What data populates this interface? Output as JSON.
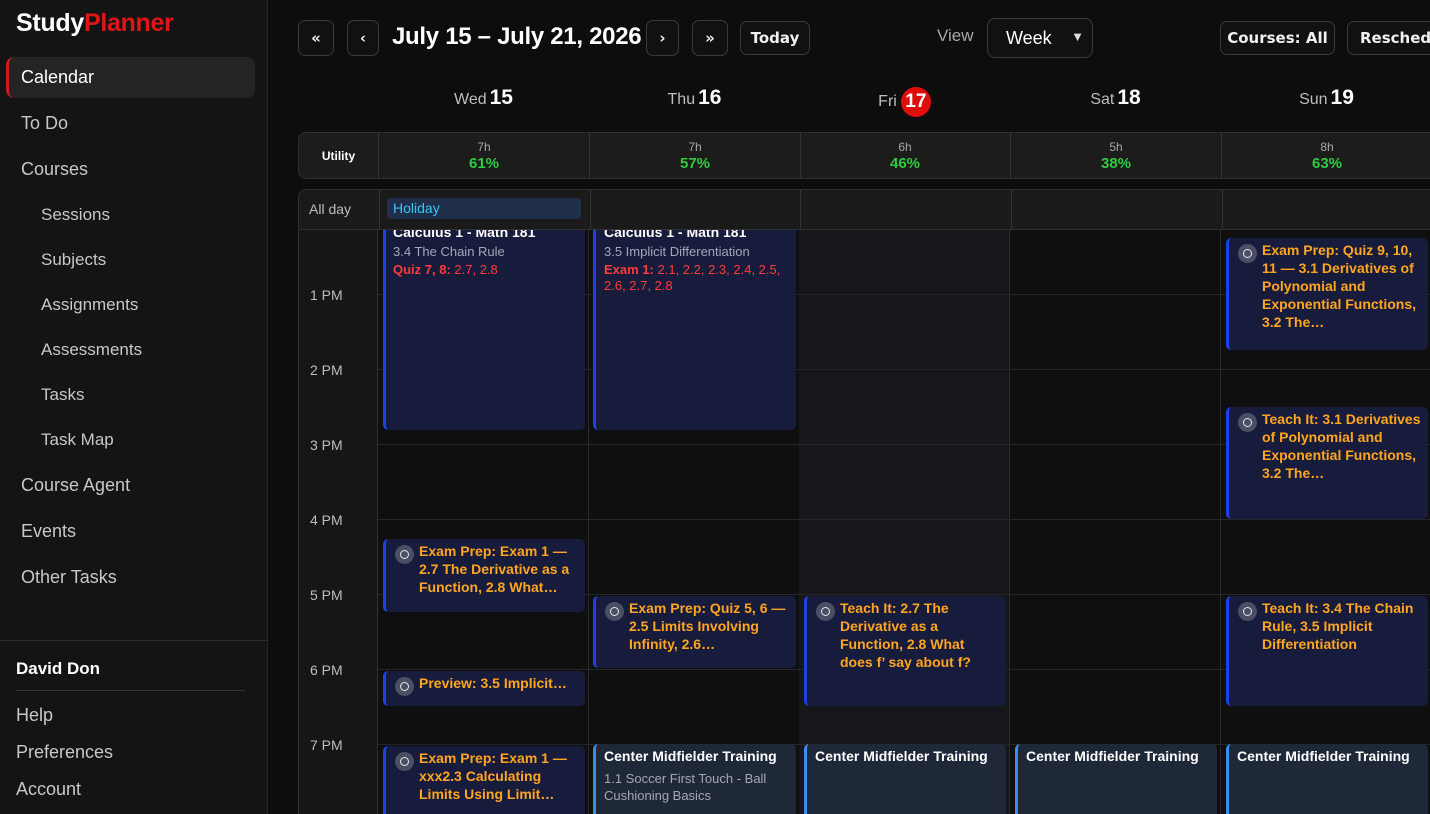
{
  "app": {
    "logo_part1": "Study",
    "logo_part2": "Planner"
  },
  "sidebar": {
    "active": "Calendar",
    "items": [
      {
        "label": "To Do"
      },
      {
        "label": "Courses"
      },
      {
        "label": "Sessions"
      },
      {
        "label": "Subjects"
      },
      {
        "label": "Assignments"
      },
      {
        "label": "Assessments"
      },
      {
        "label": "Tasks"
      },
      {
        "label": "Task Map"
      },
      {
        "label": "Course Agent"
      },
      {
        "label": "Events"
      },
      {
        "label": "Other Tasks"
      }
    ],
    "user": "David Don",
    "footer": [
      "Help",
      "Preferences",
      "Account"
    ]
  },
  "toolbar": {
    "first": "«",
    "prev": "‹",
    "next": "›",
    "last": "»",
    "range": "July 15 – July 21, 2026",
    "today": "Today",
    "view_label": "View",
    "view_value": "Week",
    "courses": "Courses: All",
    "reschedule": "Reschedu"
  },
  "days": [
    {
      "name": "Wed",
      "num": "15"
    },
    {
      "name": "Thu",
      "num": "16"
    },
    {
      "name": "Fri",
      "num": "17"
    },
    {
      "name": "Sat",
      "num": "18"
    },
    {
      "name": "Sun",
      "num": "19"
    }
  ],
  "utility": {
    "label": "Utility",
    "cells": [
      {
        "hours": "7h",
        "percent": "61%"
      },
      {
        "hours": "7h",
        "percent": "57%"
      },
      {
        "hours": "6h",
        "percent": "46%"
      },
      {
        "hours": "5h",
        "percent": "38%"
      },
      {
        "hours": "8h",
        "percent": "63%"
      }
    ]
  },
  "allday": {
    "label": "All day",
    "holiday": "Holiday"
  },
  "times": [
    "1 PM",
    "2 PM",
    "3 PM",
    "4 PM",
    "5 PM",
    "6 PM",
    "7 PM"
  ],
  "events": {
    "wed_class": {
      "title": "Calculus 1 - Math 181",
      "subtitle": "3.4 The Chain Rule",
      "due_label": "Quiz 7, 8:",
      "due_items": "2.7, 2.8"
    },
    "thu_class": {
      "title": "Calculus 1 - Math 181",
      "subtitle": "3.5 Implicit Differentiation",
      "due_label": "Exam 1:",
      "due_items": "2.1, 2.2, 2.3, 2.4, 2.5, 2.6, 2.7, 2.8"
    },
    "sun_exam_prep": "Exam Prep: Quiz 9, 10, 11 — 3.1 Derivatives of Polynomial and Exponential Functions, 3.2 The…",
    "sun_teach_1": "Teach It: 3.1 Derivatives of Polynomial and Exponential Functions, 3.2 The…",
    "wed_exam_prep": "Exam Prep: Exam 1 — 2.7 The Derivative as a Function, 2.8 What…",
    "thu_exam_prep": "Exam Prep: Quiz 5, 6 — 2.5 Limits Involving Infinity, 2.6…",
    "fri_teach": "Teach It: 2.7 The Derivative as a Function, 2.8 What does f’ say about f?",
    "sun_teach_2": "Teach It: 3.4 The Chain Rule, 3.5 Implicit Differentiation",
    "wed_preview": "Preview: 3.5 Implicit…",
    "wed_exam_prep_2": "Exam Prep: Exam 1 — xxx2.3 Calculating Limits Using Limit…",
    "training_title": "Center Midfielder Training",
    "thu_training_sub": "1.1 Soccer First Touch - Ball Cushioning Basics"
  }
}
